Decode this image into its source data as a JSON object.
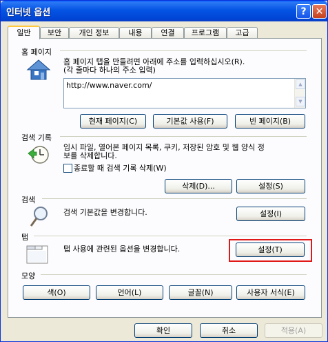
{
  "window": {
    "title": "인터넷 옵션"
  },
  "titlebar": {
    "help_glyph": "?",
    "close_glyph": "✕"
  },
  "tabs": [
    "일반",
    "보안",
    "개인 정보",
    "내용",
    "연결",
    "프로그램",
    "고급"
  ],
  "home": {
    "label": "홈 페이지",
    "desc_line1": "홈 페이지 탭을 만들려면 아래에 주소를 입력하십시오(R).",
    "desc_line2": "(각 줄마다 하나의 주소 입력)",
    "url": "http://www.naver.com/",
    "btn_current": "현재 페이지(C)",
    "btn_default": "기본값 사용(F)",
    "btn_blank": "빈 페이지(B)",
    "icon": "house-icon"
  },
  "history": {
    "label": "검색 기록",
    "desc_line1": "임시 파일, 열어본 페이지 목록, 쿠키, 저장된 암호 및 웹 양식 정",
    "desc_line2": "보를 삭제합니다.",
    "checkbox_label": "종료할 때 검색 기록 삭제(W)",
    "checkbox_checked": false,
    "btn_delete": "삭제(D)...",
    "btn_settings": "설정(S)",
    "icon": "history-clock-icon"
  },
  "search": {
    "label": "검색",
    "desc": "검색 기본값을 변경합니다.",
    "btn_settings": "설정(I)",
    "icon": "magnifier-icon"
  },
  "tabs_section": {
    "label": "탭",
    "desc": "탭 사용에 관련된 옵션을 변경합니다.",
    "btn_settings": "설정(T)",
    "icon": "tabs-window-icon"
  },
  "appearance": {
    "label": "모양",
    "btn_colors": "색(O)",
    "btn_languages": "언어(L)",
    "btn_fonts": "글꼴(N)",
    "btn_accessibility": "사용자 서식(E)"
  },
  "footer": {
    "ok": "확인",
    "cancel": "취소",
    "apply": "적용(A)"
  },
  "colors": {
    "titlebar": "#0054e3",
    "highlight": "#e01818",
    "tab_active_top": "#ffc83c"
  }
}
